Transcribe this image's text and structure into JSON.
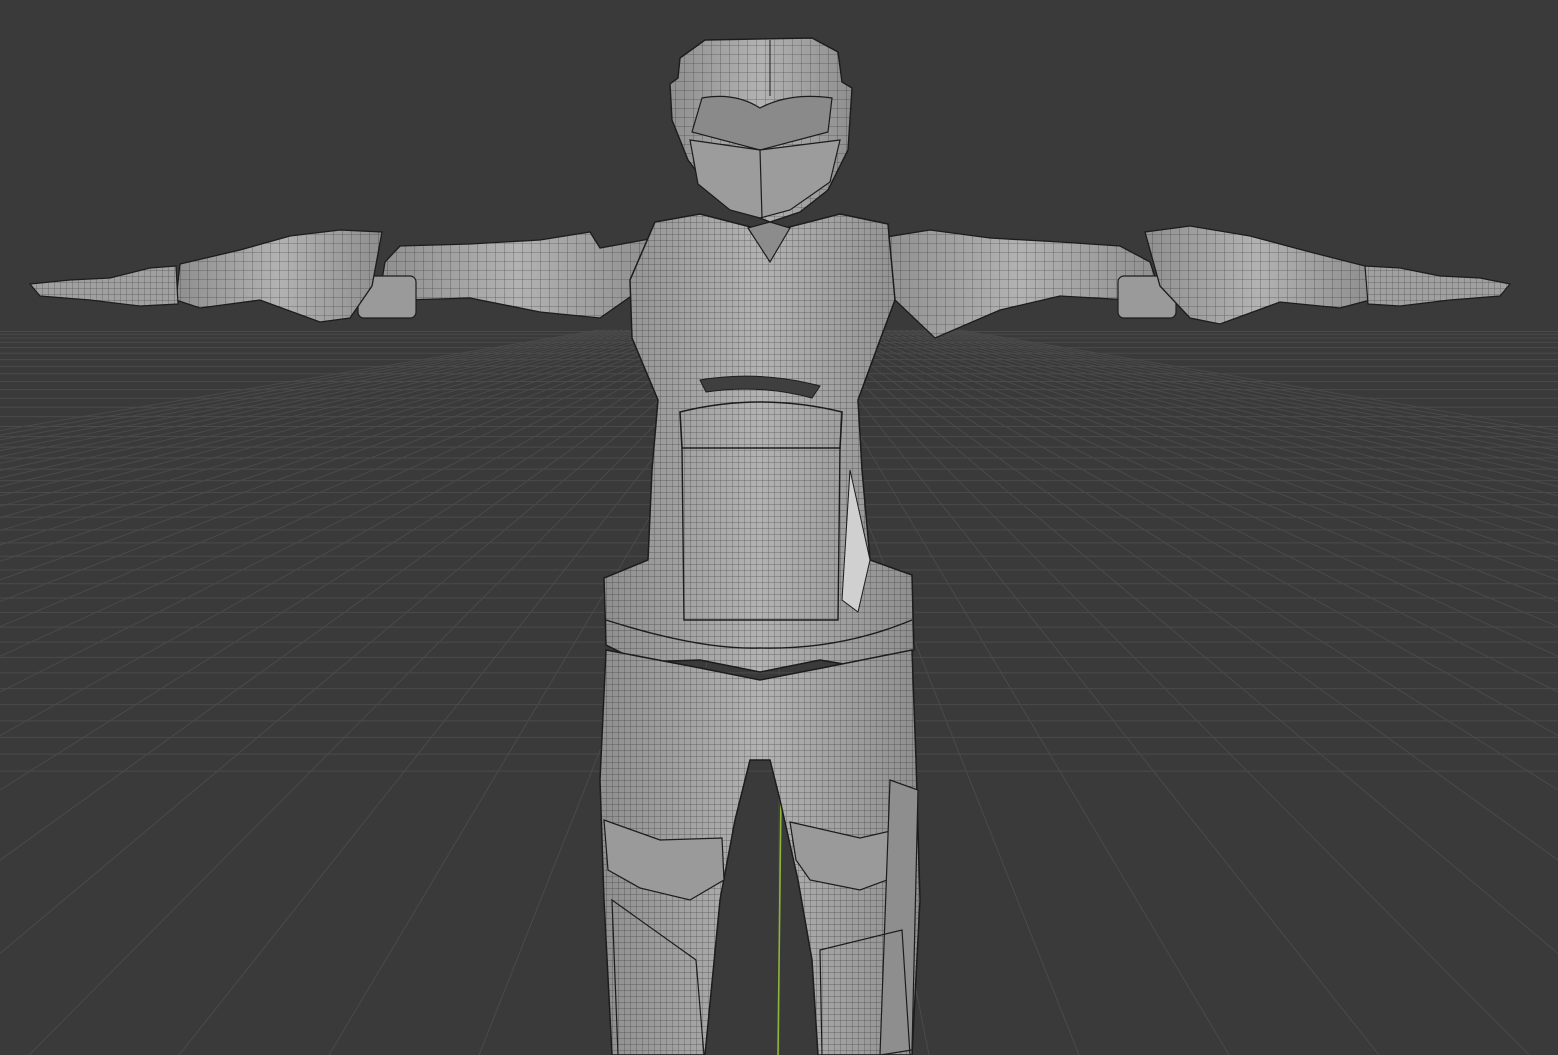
{
  "viewport": {
    "kind": "3d-viewport",
    "shading": "solid",
    "overlay": "wireframe",
    "background_color": "#3a3a3a",
    "grid_line_color": "#4a4a4a",
    "z_axis_color": "#8fb43a",
    "mesh_color": "#a7a7a7",
    "mesh_edge_color": "#1c1c1c"
  },
  "scene": {
    "object": "armored-humanoid-mesh",
    "pose": "t-pose"
  }
}
